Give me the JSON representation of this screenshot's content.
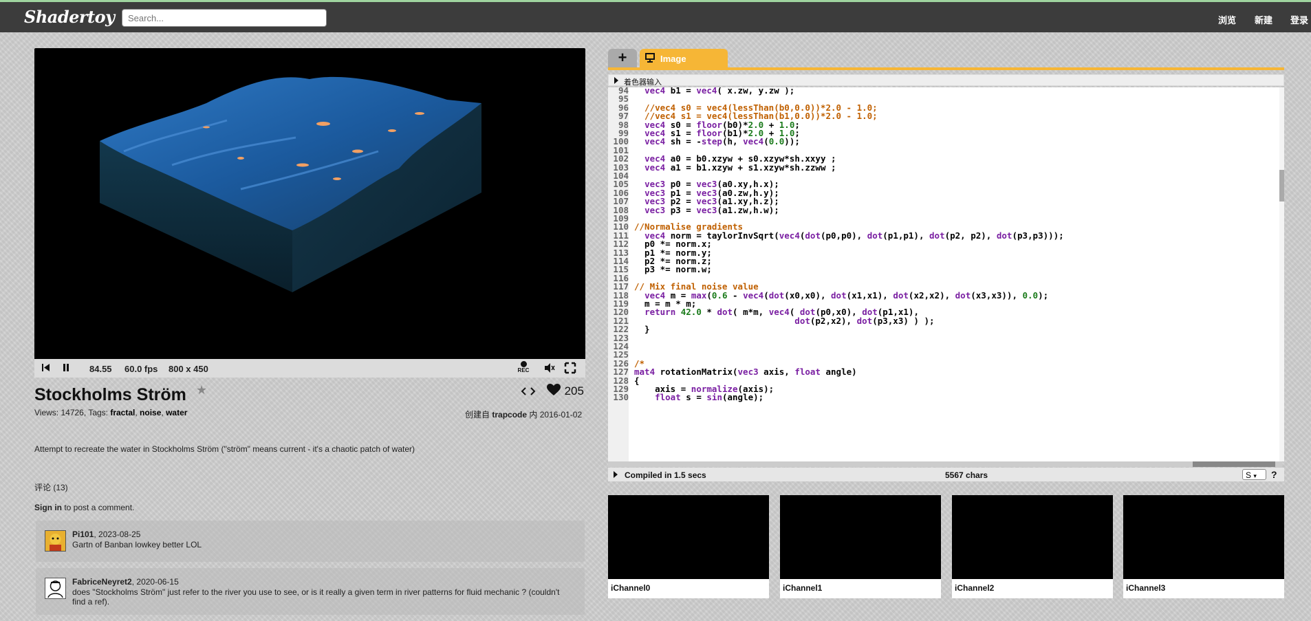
{
  "header": {
    "logo": "Shadertoy",
    "search_placeholder": "Search...",
    "nav": [
      "浏览",
      "新建",
      "登录"
    ]
  },
  "player": {
    "time": "84.55",
    "fps": "60.0 fps",
    "resolution": "800 x 450",
    "rec_label": "REC"
  },
  "shader": {
    "title": "Stockholms Ström",
    "views_label": "Views:",
    "views": "14726",
    "tags_label": "Tags:",
    "tags": [
      "fractal",
      "noise",
      "water"
    ],
    "likes": "205",
    "created_prefix": "创建自",
    "author": "trapcode",
    "created_mid": "内",
    "date": "2016-01-02",
    "description": "Attempt to recreate the water in Stockholms Ström (\"ström\" means current - it's a chaotic patch of water)"
  },
  "comments": {
    "header": "评论 (13)",
    "signin_link": "Sign in",
    "signin_text": " to post a comment.",
    "items": [
      {
        "author": "Pi101",
        "date": "2023-08-25",
        "text": "Gartn of Banban lowkey better LOL"
      },
      {
        "author": "FabriceNeyret2",
        "date": "2020-06-15",
        "text": "does \"Stockholms Ström\" just refer to the river you use to see, or is it really a given term in river patterns for fluid mechanic ? (couldn't find a ref)."
      }
    ]
  },
  "editor": {
    "tab_add": "+",
    "tab_label": "Image",
    "inputs_label": "着色器输入",
    "compiled": "Compiled in 1.5 secs",
    "chars": "5567 chars",
    "font_size_option": "S",
    "help": "?",
    "lines": [
      {
        "n": "94",
        "t": "  vec4 b1 = vec4( x.zw, y.zw );"
      },
      {
        "n": "95",
        "t": ""
      },
      {
        "n": "96",
        "t": "  //vec4 s0 = vec4(lessThan(b0,0.0))*2.0 - 1.0;"
      },
      {
        "n": "97",
        "t": "  //vec4 s1 = vec4(lessThan(b1,0.0))*2.0 - 1.0;"
      },
      {
        "n": "98",
        "t": "  vec4 s0 = floor(b0)*2.0 + 1.0;"
      },
      {
        "n": "99",
        "t": "  vec4 s1 = floor(b1)*2.0 + 1.0;"
      },
      {
        "n": "100",
        "t": "  vec4 sh = -step(h, vec4(0.0));"
      },
      {
        "n": "101",
        "t": ""
      },
      {
        "n": "102",
        "t": "  vec4 a0 = b0.xzyw + s0.xzyw*sh.xxyy ;"
      },
      {
        "n": "103",
        "t": "  vec4 a1 = b1.xzyw + s1.xzyw*sh.zzww ;"
      },
      {
        "n": "104",
        "t": ""
      },
      {
        "n": "105",
        "t": "  vec3 p0 = vec3(a0.xy,h.x);"
      },
      {
        "n": "106",
        "t": "  vec3 p1 = vec3(a0.zw,h.y);"
      },
      {
        "n": "107",
        "t": "  vec3 p2 = vec3(a1.xy,h.z);"
      },
      {
        "n": "108",
        "t": "  vec3 p3 = vec3(a1.zw,h.w);"
      },
      {
        "n": "109",
        "t": ""
      },
      {
        "n": "110",
        "t": "//Normalise gradients"
      },
      {
        "n": "111",
        "t": "  vec4 norm = taylorInvSqrt(vec4(dot(p0,p0), dot(p1,p1), dot(p2, p2), dot(p3,p3)));"
      },
      {
        "n": "112",
        "t": "  p0 *= norm.x;"
      },
      {
        "n": "113",
        "t": "  p1 *= norm.y;"
      },
      {
        "n": "114",
        "t": "  p2 *= norm.z;"
      },
      {
        "n": "115",
        "t": "  p3 *= norm.w;"
      },
      {
        "n": "116",
        "t": ""
      },
      {
        "n": "117",
        "t": "// Mix final noise value"
      },
      {
        "n": "118",
        "t": "  vec4 m = max(0.6 - vec4(dot(x0,x0), dot(x1,x1), dot(x2,x2), dot(x3,x3)), 0.0);"
      },
      {
        "n": "119",
        "t": "  m = m * m;"
      },
      {
        "n": "120",
        "t": "  return 42.0 * dot( m*m, vec4( dot(p0,x0), dot(p1,x1),"
      },
      {
        "n": "121",
        "t": "                               dot(p2,x2), dot(p3,x3) ) );"
      },
      {
        "n": "122",
        "t": "  }"
      },
      {
        "n": "123",
        "t": ""
      },
      {
        "n": "124",
        "t": ""
      },
      {
        "n": "125",
        "t": ""
      },
      {
        "n": "126",
        "t": "/*"
      },
      {
        "n": "127",
        "t": "mat4 rotationMatrix(vec3 axis, float angle)"
      },
      {
        "n": "128",
        "t": "{"
      },
      {
        "n": "129",
        "t": "    axis = normalize(axis);"
      },
      {
        "n": "130",
        "t": "    float s = sin(angle);"
      }
    ]
  },
  "channels": [
    "iChannel0",
    "iChannel1",
    "iChannel2",
    "iChannel3"
  ],
  "colors": {
    "topbar": "#3c3c3c",
    "accent": "#f6b636",
    "keyword": "#7a1fa2",
    "comment": "#c06000",
    "number": "#1a7a1a"
  },
  "icons": [
    "rewind-icon",
    "pause-icon",
    "rec-icon",
    "volume-icon",
    "fullscreen-icon",
    "star-icon",
    "code-share-icon",
    "heart-icon",
    "display-icon",
    "triangle-icon"
  ]
}
